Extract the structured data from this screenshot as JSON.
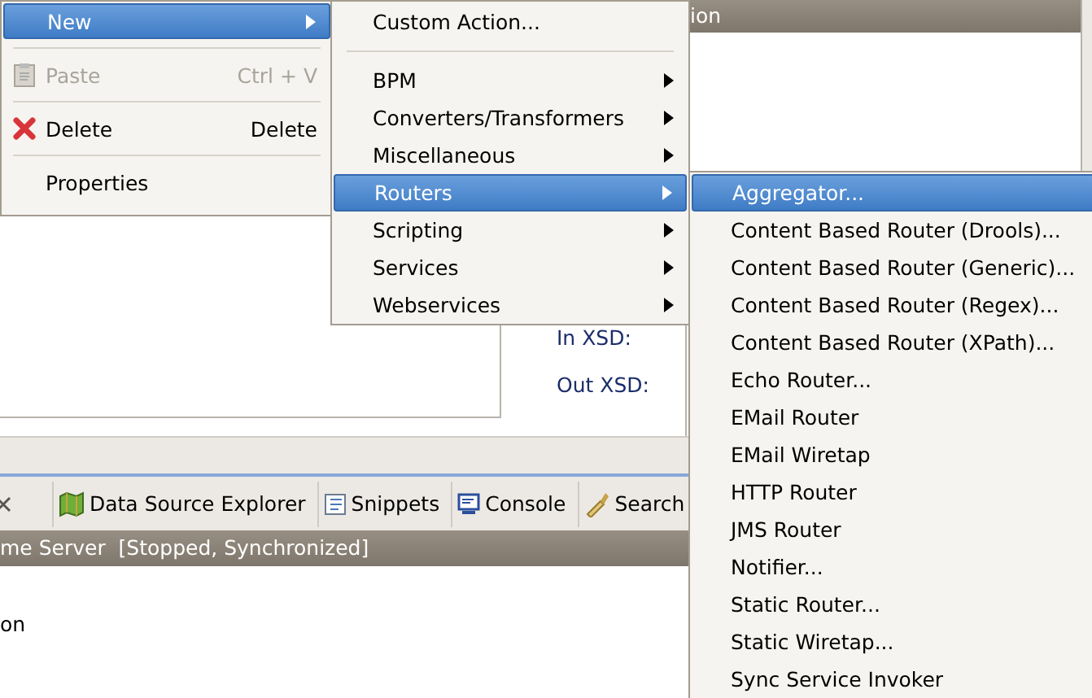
{
  "editor": {
    "header_title": "ion",
    "labels": [
      "In XSD:",
      "Out XSD:"
    ]
  },
  "bottom_panel": {
    "tabs": [
      {
        "label": "Data Source Explorer",
        "selected": false
      },
      {
        "label": "Snippets",
        "selected": false
      },
      {
        "label": "Console",
        "selected": false
      },
      {
        "label": "Search",
        "selected": false
      }
    ],
    "header_title": "me Server  [Stopped, Synchronized]",
    "body_text": "on"
  },
  "menus": [
    {
      "items": [
        {
          "kind": "item",
          "label": "New",
          "selected": true,
          "disabled": false,
          "submenu": true
        },
        {
          "kind": "separator"
        },
        {
          "kind": "item",
          "label": "Paste",
          "shortcut": "Ctrl + V",
          "selected": false,
          "disabled": true,
          "submenu": false
        },
        {
          "kind": "separator"
        },
        {
          "kind": "item",
          "label": "Delete",
          "shortcut": "Delete",
          "selected": false,
          "disabled": false,
          "submenu": false
        },
        {
          "kind": "separator"
        },
        {
          "kind": "item",
          "label": "Properties",
          "selected": false,
          "disabled": false,
          "submenu": false
        }
      ]
    },
    {
      "items": [
        {
          "kind": "item",
          "label": "Custom Action...",
          "selected": false,
          "disabled": false,
          "submenu": false
        },
        {
          "kind": "separator"
        },
        {
          "kind": "item",
          "label": "BPM",
          "selected": false,
          "disabled": false,
          "submenu": true
        },
        {
          "kind": "item",
          "label": "Converters/Transformers",
          "selected": false,
          "disabled": false,
          "submenu": true
        },
        {
          "kind": "item",
          "label": "Miscellaneous",
          "selected": false,
          "disabled": false,
          "submenu": true
        },
        {
          "kind": "item",
          "label": "Routers",
          "selected": true,
          "disabled": false,
          "submenu": true
        },
        {
          "kind": "item",
          "label": "Scripting",
          "selected": false,
          "disabled": false,
          "submenu": true
        },
        {
          "kind": "item",
          "label": "Services",
          "selected": false,
          "disabled": false,
          "submenu": true
        },
        {
          "kind": "item",
          "label": "Webservices",
          "selected": false,
          "disabled": false,
          "submenu": true
        }
      ]
    },
    {
      "items": [
        {
          "kind": "item",
          "label": "Aggregator...",
          "selected": true,
          "disabled": false,
          "submenu": false
        },
        {
          "kind": "item",
          "label": "Content Based Router (Drools)...",
          "selected": false,
          "disabled": false,
          "submenu": false
        },
        {
          "kind": "item",
          "label": "Content Based Router (Generic)...",
          "selected": false,
          "disabled": false,
          "submenu": false
        },
        {
          "kind": "item",
          "label": "Content Based Router (Regex)...",
          "selected": false,
          "disabled": false,
          "submenu": false
        },
        {
          "kind": "item",
          "label": "Content Based Router (XPath)...",
          "selected": false,
          "disabled": false,
          "submenu": false
        },
        {
          "kind": "item",
          "label": "Echo Router...",
          "selected": false,
          "disabled": false,
          "submenu": false
        },
        {
          "kind": "item",
          "label": "EMail Router",
          "selected": false,
          "disabled": false,
          "submenu": false
        },
        {
          "kind": "item",
          "label": "EMail Wiretap",
          "selected": false,
          "disabled": false,
          "submenu": false
        },
        {
          "kind": "item",
          "label": "HTTP Router",
          "selected": false,
          "disabled": false,
          "submenu": false
        },
        {
          "kind": "item",
          "label": "JMS Router",
          "selected": false,
          "disabled": false,
          "submenu": false
        },
        {
          "kind": "item",
          "label": "Notifier...",
          "selected": false,
          "disabled": false,
          "submenu": false
        },
        {
          "kind": "item",
          "label": "Static Router...",
          "selected": false,
          "disabled": false,
          "submenu": false
        },
        {
          "kind": "item",
          "label": "Static Wiretap...",
          "selected": false,
          "disabled": false,
          "submenu": false
        },
        {
          "kind": "item",
          "label": "Sync Service Invoker",
          "selected": false,
          "disabled": false,
          "submenu": false
        }
      ]
    }
  ]
}
